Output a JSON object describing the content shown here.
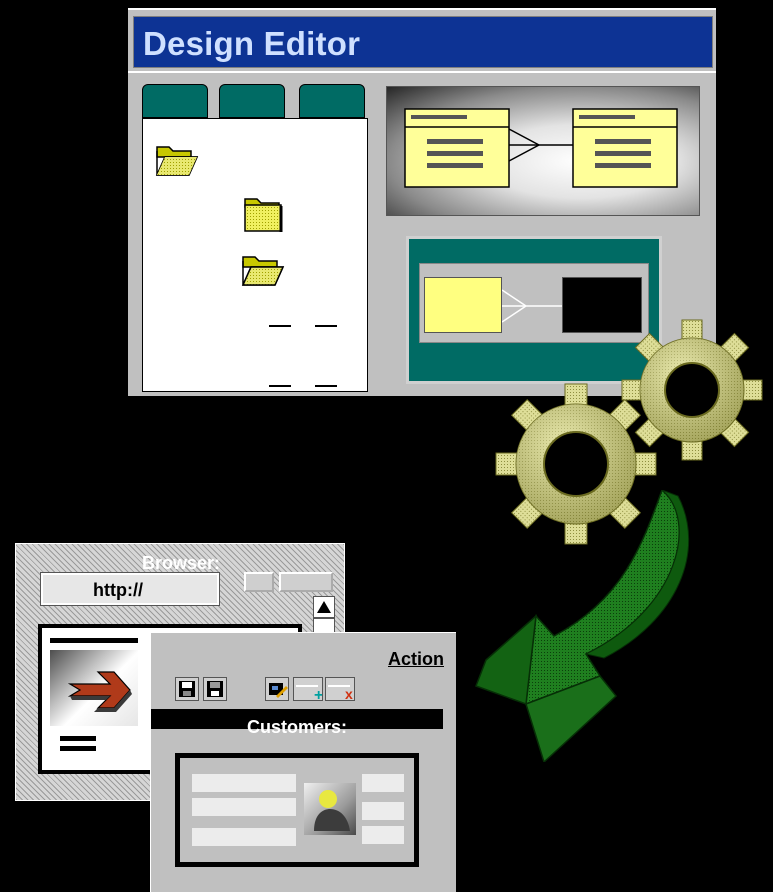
{
  "design_editor": {
    "title": "Design Editor",
    "tabs": [
      "",
      "",
      ""
    ],
    "tree_items": [
      "open-folder",
      "closed-folder",
      "open-folder"
    ]
  },
  "browser": {
    "caption": "Browser:",
    "url": "http://"
  },
  "customers_form": {
    "action_label": "Action",
    "title": "Customers:",
    "toolbar_icons": [
      "save-icon",
      "print-icon",
      "edit-icon",
      "add-record-icon",
      "delete-record-icon"
    ]
  },
  "decorations": [
    "gears-icon",
    "green-arrow-icon"
  ],
  "colors": {
    "title_bar": "#0d3394",
    "teal": "#006b64",
    "entity_yellow": "#ffff80",
    "gear_gold": "#d8d890",
    "arrow_green": "#1e7a1e"
  }
}
